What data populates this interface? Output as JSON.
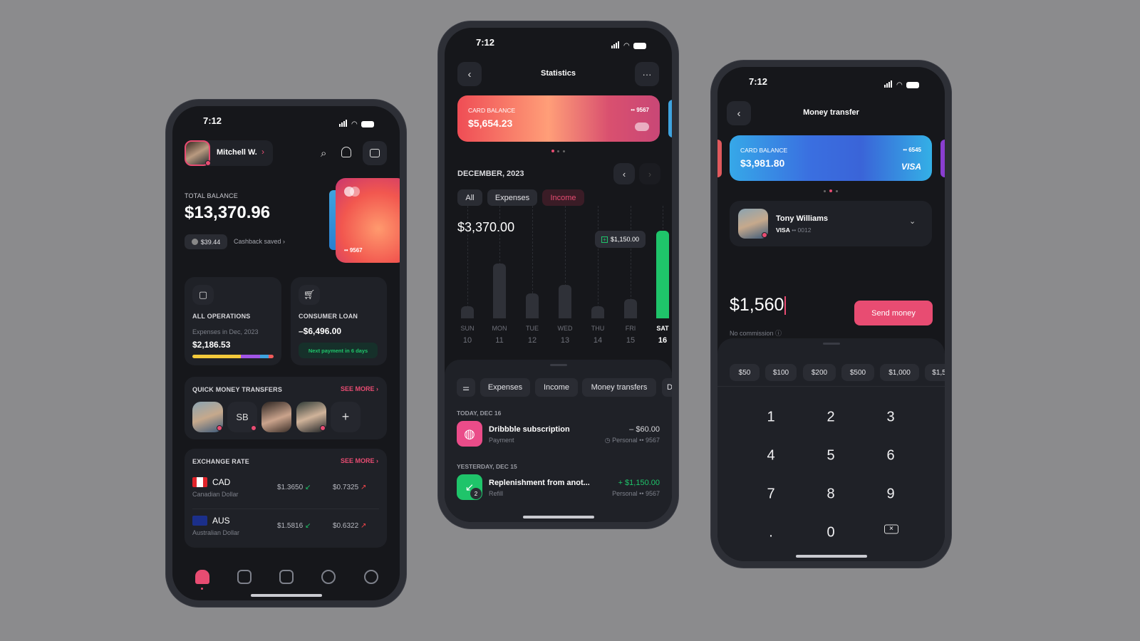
{
  "status_time": "7:12",
  "home": {
    "user_name": "Mitchell W.",
    "total_balance_label": "TOTAL BALANCE",
    "total_balance": "$13,370.96",
    "cashback_amount": "$39.44",
    "cashback_label": "Cashback saved",
    "card_number": "•• 9567",
    "operations": {
      "title": "ALL OPERATIONS",
      "subtitle": "Expenses in Dec, 2023",
      "amount": "$2,186.53",
      "bar_segments": [
        {
          "share": 0.6,
          "color": "#f3c93b"
        },
        {
          "share": 0.23,
          "color": "#a155e6"
        },
        {
          "share": 0.11,
          "color": "#3ea3df"
        },
        {
          "share": 0.06,
          "color": "#f05a5a"
        }
      ]
    },
    "loan": {
      "title": "CONSUMER LOAN",
      "amount": "–$6,496.00",
      "note": "Next payment in 6 days"
    },
    "quick_transfers": {
      "title": "QUICK MONEY TRANSFERS",
      "see_more": "SEE MORE",
      "initials": "SB",
      "add": "+"
    },
    "exchange": {
      "title": "EXCHANGE RATE",
      "see_more": "SEE MORE",
      "rows": [
        {
          "code": "CAD",
          "name": "Canadian Dollar",
          "buy": "$1.3650",
          "sell": "$0.7325"
        },
        {
          "code": "AUS",
          "name": "Australian Dollar",
          "buy": "$1.5816",
          "sell": "$0.6322"
        }
      ]
    },
    "nav": [
      "home",
      "card",
      "chart",
      "chat",
      "history"
    ]
  },
  "stats": {
    "title": "Statistics",
    "card_label": "CARD BALANCE",
    "card_balance": "$5,654.23",
    "card_number": "•• 9567",
    "month": "DECEMBER, 2023",
    "tabs": [
      "All",
      "Expenses",
      "Income"
    ],
    "active_tab": "Income",
    "total": "$3,370.00",
    "tooltip": "$1,150.00",
    "chart_data": {
      "type": "bar",
      "categories": [
        "SUN",
        "MON",
        "TUE",
        "WED",
        "THU",
        "FRI",
        "SAT"
      ],
      "dates": [
        "10",
        "11",
        "12",
        "13",
        "14",
        "15",
        "16"
      ],
      "values": [
        160,
        720,
        330,
        440,
        160,
        250,
        1150
      ],
      "highlight": "SAT",
      "highlight_color": "#1fc46a"
    },
    "filters": [
      "Expenses",
      "Income",
      "Money transfers",
      "D"
    ],
    "groups": [
      {
        "date": "TODAY, DEC 16",
        "title": "Dribbble subscription",
        "sub": "Payment",
        "amount": "– $60.00",
        "account": "Personal •• 9567"
      },
      {
        "date": "YESTERDAY, DEC 15",
        "title": "Replenishment from anot...",
        "sub": "Refill",
        "amount": "+ $1,150.00",
        "account": "Personal •• 9567",
        "badge": "2"
      }
    ]
  },
  "transfer": {
    "title": "Money transfer",
    "card_label": "CARD BALANCE",
    "card_balance": "$3,981.80",
    "card_number": "•• 6545",
    "card_brand": "VISA",
    "recipient": {
      "name": "Tony Williams",
      "brand": "VISA",
      "number": "•• 0012"
    },
    "amount": "$1,560",
    "commission": "No commission",
    "send": "Send money",
    "presets": [
      "$50",
      "$100",
      "$200",
      "$500",
      "$1,000",
      "$1,5"
    ],
    "keys": [
      "1",
      "2",
      "3",
      "4",
      "5",
      "6",
      "7",
      "8",
      "9",
      ".",
      "0"
    ]
  },
  "colors": {
    "accent": "#e84c72",
    "positive": "#1fc46a",
    "background": "#16171b"
  }
}
